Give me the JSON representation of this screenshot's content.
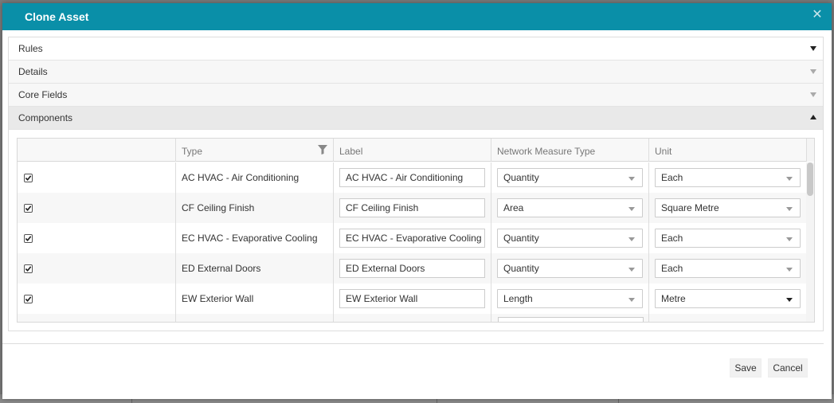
{
  "dialog": {
    "title": "Clone Asset"
  },
  "accordion": [
    {
      "label": "Rules",
      "state": "collapsed-active"
    },
    {
      "label": "Details",
      "state": "collapsed"
    },
    {
      "label": "Core Fields",
      "state": "collapsed"
    },
    {
      "label": "Components",
      "state": "expanded"
    }
  ],
  "grid": {
    "columns": [
      "",
      "Type",
      "Label",
      "Network Measure Type",
      "Unit"
    ],
    "rows": [
      {
        "checked": true,
        "type": "AC HVAC - Air Conditioning",
        "label": "AC HVAC - Air Conditioning",
        "measure": "Quantity",
        "unit": "Each"
      },
      {
        "checked": true,
        "type": "CF Ceiling Finish",
        "label": "CF Ceiling Finish",
        "measure": "Area",
        "unit": "Square Metre"
      },
      {
        "checked": true,
        "type": "EC HVAC - Evaporative Cooling",
        "label": "EC HVAC - Evaporative Cooling",
        "measure": "Quantity",
        "unit": "Each"
      },
      {
        "checked": true,
        "type": "ED External Doors",
        "label": "ED External Doors",
        "measure": "Quantity",
        "unit": "Each"
      },
      {
        "checked": true,
        "type": "EW Exterior Wall",
        "label": "EW Exterior Wall",
        "measure": "Length",
        "unit": "Metre"
      }
    ]
  },
  "footer": {
    "save_label": "Save",
    "cancel_label": "Cancel"
  },
  "icons": {
    "close": "close-icon",
    "filter": "filter-icon",
    "check": "checkmark-icon",
    "caret": "caret-down-icon"
  },
  "colors": {
    "titlebar": "#0a8fa8",
    "overlay": "#7a7a7a"
  }
}
